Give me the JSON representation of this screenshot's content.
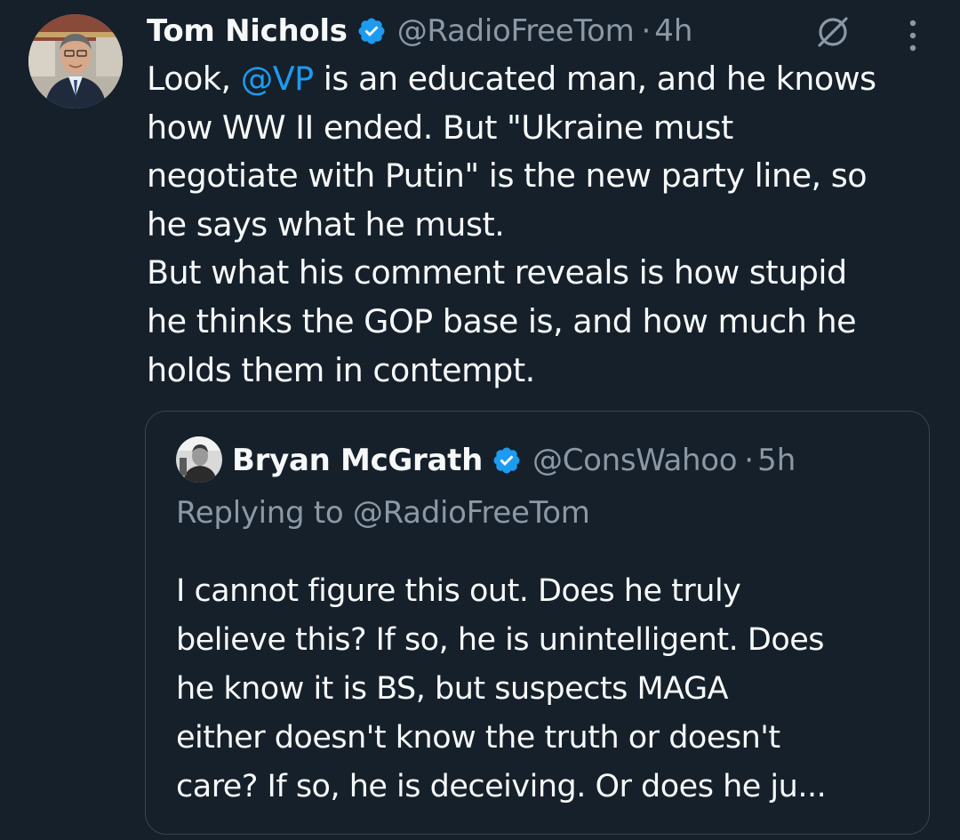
{
  "tweet": {
    "author_name": "Tom Nichols",
    "author_handle": "@RadioFreeTom",
    "separator": "·",
    "time": "4h",
    "verified_icon": "verified-badge-icon",
    "verified_color": "#1d9bf0",
    "text_lines": [
      {
        "pre": "Look, ",
        "mention": "@VP",
        "post": " is an educated man, and he knows"
      },
      {
        "pre": "how WW II ended. But \"Ukraine must"
      },
      {
        "pre": "negotiate with Putin\" is the new party line, so"
      },
      {
        "pre": "he says what he must."
      },
      {
        "pre": "But what his comment reveals is how stupid"
      },
      {
        "pre": "he thinks the GOP base is, and how much he"
      },
      {
        "pre": "holds them in contempt."
      }
    ]
  },
  "quoted_tweet": {
    "author_name": "Bryan McGrath",
    "author_handle": "@ConsWahoo",
    "separator": "·",
    "time": "5h",
    "replying_to": "Replying to @RadioFreeTom",
    "text_lines": [
      "I cannot figure this out. Does he truly",
      "believe this? If so, he is unintelligent. Does",
      "he know it is BS, but suspects MAGA",
      "either doesn't know the truth or doesn't",
      "care? If so, he is deceiving. Or does he ju..."
    ]
  },
  "theme": {
    "background": "#15202b",
    "text_primary": "#f7f9f9",
    "text_secondary": "#8b98a5",
    "link": "#1d9bf0",
    "border": "#38444d"
  },
  "icons": {
    "grok": "grok-icon",
    "more": "more-options-icon"
  }
}
